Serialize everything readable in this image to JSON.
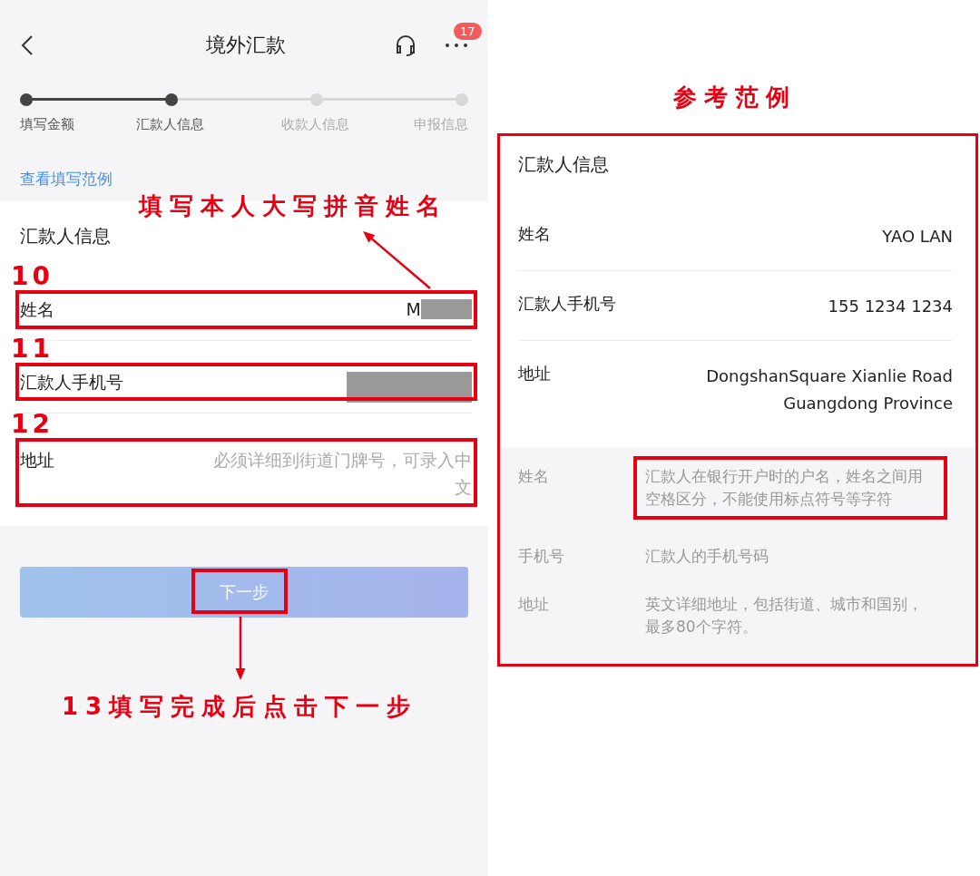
{
  "phone": {
    "title": "境外汇款",
    "badge": "17",
    "steps": [
      {
        "label": "填写金额",
        "completed": true
      },
      {
        "label": "汇款人信息",
        "completed": true
      },
      {
        "label": "收款人信息",
        "completed": false
      },
      {
        "label": "申报信息",
        "completed": false
      }
    ],
    "example_link": "查看填写范例",
    "section_title": "汇款人信息",
    "fields": [
      {
        "label": "姓名",
        "value": "M",
        "redacted": true
      },
      {
        "label": "汇款人手机号",
        "redacted": true
      },
      {
        "label": "地址",
        "placeholder": "必须详细到街道门牌号，可录入中文"
      }
    ],
    "next_button": {
      "label": "下一步",
      "disabled": true
    }
  },
  "example": {
    "heading": "参考范例",
    "section_title": "汇款人信息",
    "rows": [
      {
        "label": "姓名",
        "value": "YAO LAN"
      },
      {
        "label": "汇款人手机号",
        "value": "155 1234 1234"
      },
      {
        "label": "地址",
        "value": "DongshanSquare Xianlie Road Guangdong Province"
      }
    ],
    "notes": [
      {
        "label": "姓名",
        "text": "汇款人在银行开户时的户名，姓名之间用空格区分，不能使用标点符号等字符",
        "highlighted": true
      },
      {
        "label": "手机号",
        "text": "汇款人的手机号码",
        "highlighted": false
      },
      {
        "label": "地址",
        "text": "英文详细地址，包括街道、城市和国别，最多80个字符。",
        "highlighted": false
      }
    ]
  },
  "annotations": {
    "name_hint": "填写本人大写拼音姓名",
    "step_numbers": [
      "10",
      "11",
      "12"
    ],
    "final_hint": "13填写完成后点击下一步"
  }
}
